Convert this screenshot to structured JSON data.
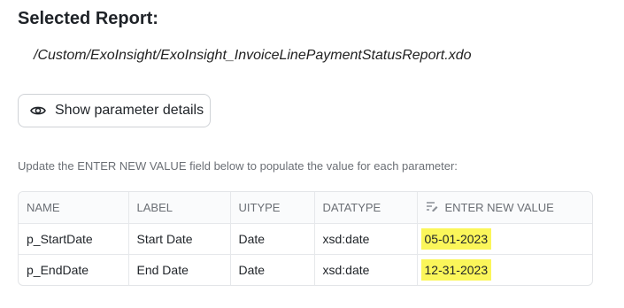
{
  "header": {
    "title": "Selected Report:",
    "report_path": "/Custom/ExoInsight/ExoInsight_InvoiceLinePaymentStatusReport.xdo"
  },
  "parameter_button": {
    "label": "Show parameter details",
    "icon": "eye-icon"
  },
  "hint_text": "Update the ENTER NEW VALUE field below to populate the value for each parameter:",
  "table": {
    "columns": {
      "name": "NAME",
      "label": "LABEL",
      "uitype": "UITYPE",
      "datatype": "DATATYPE",
      "value": "ENTER NEW VALUE",
      "value_icon": "edit-lines-icon"
    },
    "rows": [
      {
        "name": "p_StartDate",
        "label": "Start Date",
        "uitype": "Date",
        "datatype": "xsd:date",
        "value": "05-01-2023"
      },
      {
        "name": "p_EndDate",
        "label": "End Date",
        "uitype": "Date",
        "datatype": "xsd:date",
        "value": "12-31-2023"
      }
    ]
  },
  "colors": {
    "highlight": "#fbf65a",
    "border": "#e3e5e8",
    "muted_text": "#6b6f75"
  }
}
